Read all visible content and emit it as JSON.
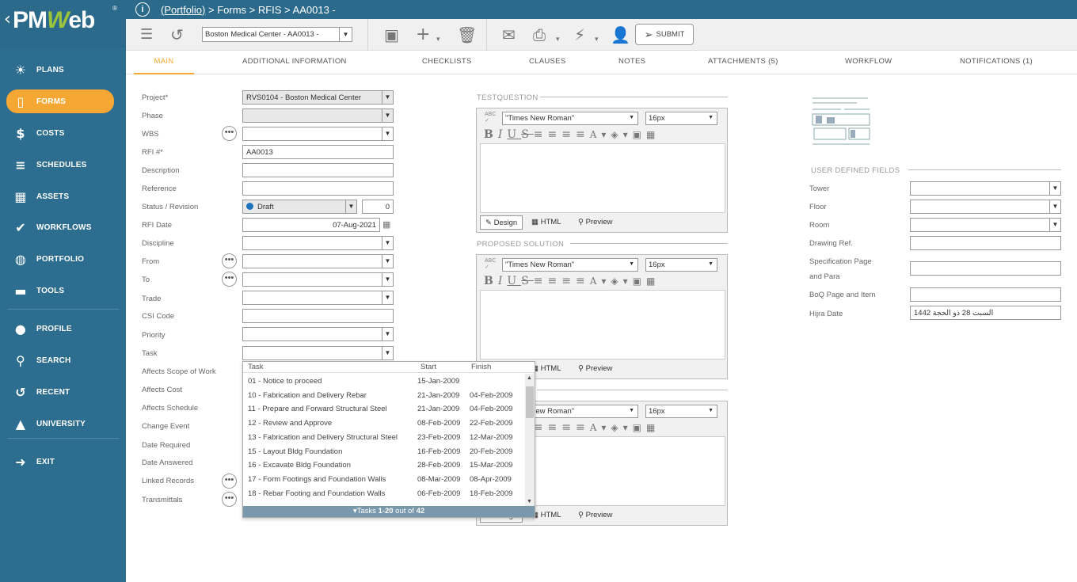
{
  "logo": {
    "text_pm": "PM",
    "text_w": "W",
    "text_eb": "eb"
  },
  "nav": [
    {
      "label": "PLANS",
      "icon": "lightbulb-icon",
      "glyph": "☀"
    },
    {
      "label": "FORMS",
      "icon": "forms-icon",
      "glyph": "▯"
    },
    {
      "label": "COSTS",
      "icon": "dollar-icon",
      "glyph": "$"
    },
    {
      "label": "SCHEDULES",
      "icon": "schedules-icon",
      "glyph": "≡"
    },
    {
      "label": "ASSETS",
      "icon": "building-icon",
      "glyph": "▦"
    },
    {
      "label": "WORKFLOWS",
      "icon": "check-icon",
      "glyph": "✔"
    },
    {
      "label": "PORTFOLIO",
      "icon": "globe-icon",
      "glyph": "◍"
    },
    {
      "label": "TOOLS",
      "icon": "briefcase-icon",
      "glyph": "▬"
    },
    {
      "label": "PROFILE",
      "icon": "user-icon",
      "glyph": "●"
    },
    {
      "label": "SEARCH",
      "icon": "search-icon",
      "glyph": "⚲"
    },
    {
      "label": "RECENT",
      "icon": "history-icon",
      "glyph": "↺"
    },
    {
      "label": "UNIVERSITY",
      "icon": "graduation-icon",
      "glyph": "▲"
    },
    {
      "label": "EXIT",
      "icon": "exit-icon",
      "glyph": "➜"
    }
  ],
  "breadcrumb": {
    "portfolio": "(Portfolio)",
    "rest": "> Forms > RFIS > AA0013 -"
  },
  "toolbar": {
    "record_select": "Boston Medical Center - AA0013 -",
    "submit": "SUBMIT"
  },
  "tabs": [
    "MAIN",
    "ADDITIONAL INFORMATION",
    "CHECKLISTS",
    "CLAUSES",
    "NOTES",
    "ATTACHMENTS (5)",
    "WORKFLOW",
    "NOTIFICATIONS (1)"
  ],
  "form": {
    "labels": [
      "Project*",
      "Phase",
      "WBS",
      "RFI #*",
      "Description",
      "Reference",
      "Status / Revision",
      "RFI Date",
      "Discipline",
      "From",
      "To",
      "Trade",
      "CSI Code",
      "Priority",
      "Task",
      "Affects Scope of Work",
      "Affects Cost",
      "Affects Schedule",
      "Change Event",
      "Date Required",
      "Date Answered",
      "Linked Records",
      "Transmittals"
    ],
    "project": "RVS0104 - Boston Medical Center",
    "rfi_number": "AA0013",
    "status": "Draft",
    "revision": "0",
    "rfi_date": "07-Aug-2021"
  },
  "editors": [
    {
      "title": "TESTQUESTION",
      "font": "\"Times New Roman\"",
      "size": "16px"
    },
    {
      "title": "PROPOSED SOLUTION",
      "font": "\"Times New Roman\"",
      "size": "16px"
    },
    {
      "title": "",
      "font": "\"Times New Roman\"",
      "size": "16px"
    }
  ],
  "editor_modes": {
    "design": "Design",
    "html": "HTML",
    "preview": "Preview"
  },
  "udf": {
    "title": "USER DEFINED FIELDS",
    "labels": [
      "Tower",
      "Floor",
      "Room",
      "Drawing Ref.",
      "Specification Page",
      "and Para",
      "BoQ Page and Item",
      "Hijra Date"
    ],
    "hijra_value": "السبت 28 ذو الحجة 1442"
  },
  "task_popup": {
    "headers": [
      "Task",
      "Start",
      "Finish"
    ],
    "rows": [
      [
        "01 - Notice to proceed",
        "15-Jan-2009",
        ""
      ],
      [
        "10 - Fabrication and Delivery Rebar",
        "21-Jan-2009",
        "04-Feb-2009"
      ],
      [
        "11 - Prepare and Forward Structural Steel",
        "21-Jan-2009",
        "04-Feb-2009"
      ],
      [
        "12 - Review and Approve",
        "08-Feb-2009",
        "22-Feb-2009"
      ],
      [
        "13 - Fabrication and Delivery Structural Steel",
        "23-Feb-2009",
        "12-Mar-2009"
      ],
      [
        "15 - Layout Bldg Foundation",
        "16-Feb-2009",
        "20-Feb-2009"
      ],
      [
        "16 - Excavate Bldg Foundation",
        "28-Feb-2009",
        "15-Mar-2009"
      ],
      [
        "17 - Form Footings and Foundation Walls",
        "08-Mar-2009",
        "08-Apr-2009"
      ],
      [
        "18 - Rebar Footing and Foundation Walls",
        "06-Feb-2009",
        "18-Feb-2009"
      ]
    ],
    "footer_prefix": "▾Tasks ",
    "footer_range": "1-20",
    "footer_mid": " out of ",
    "footer_total": "42"
  }
}
